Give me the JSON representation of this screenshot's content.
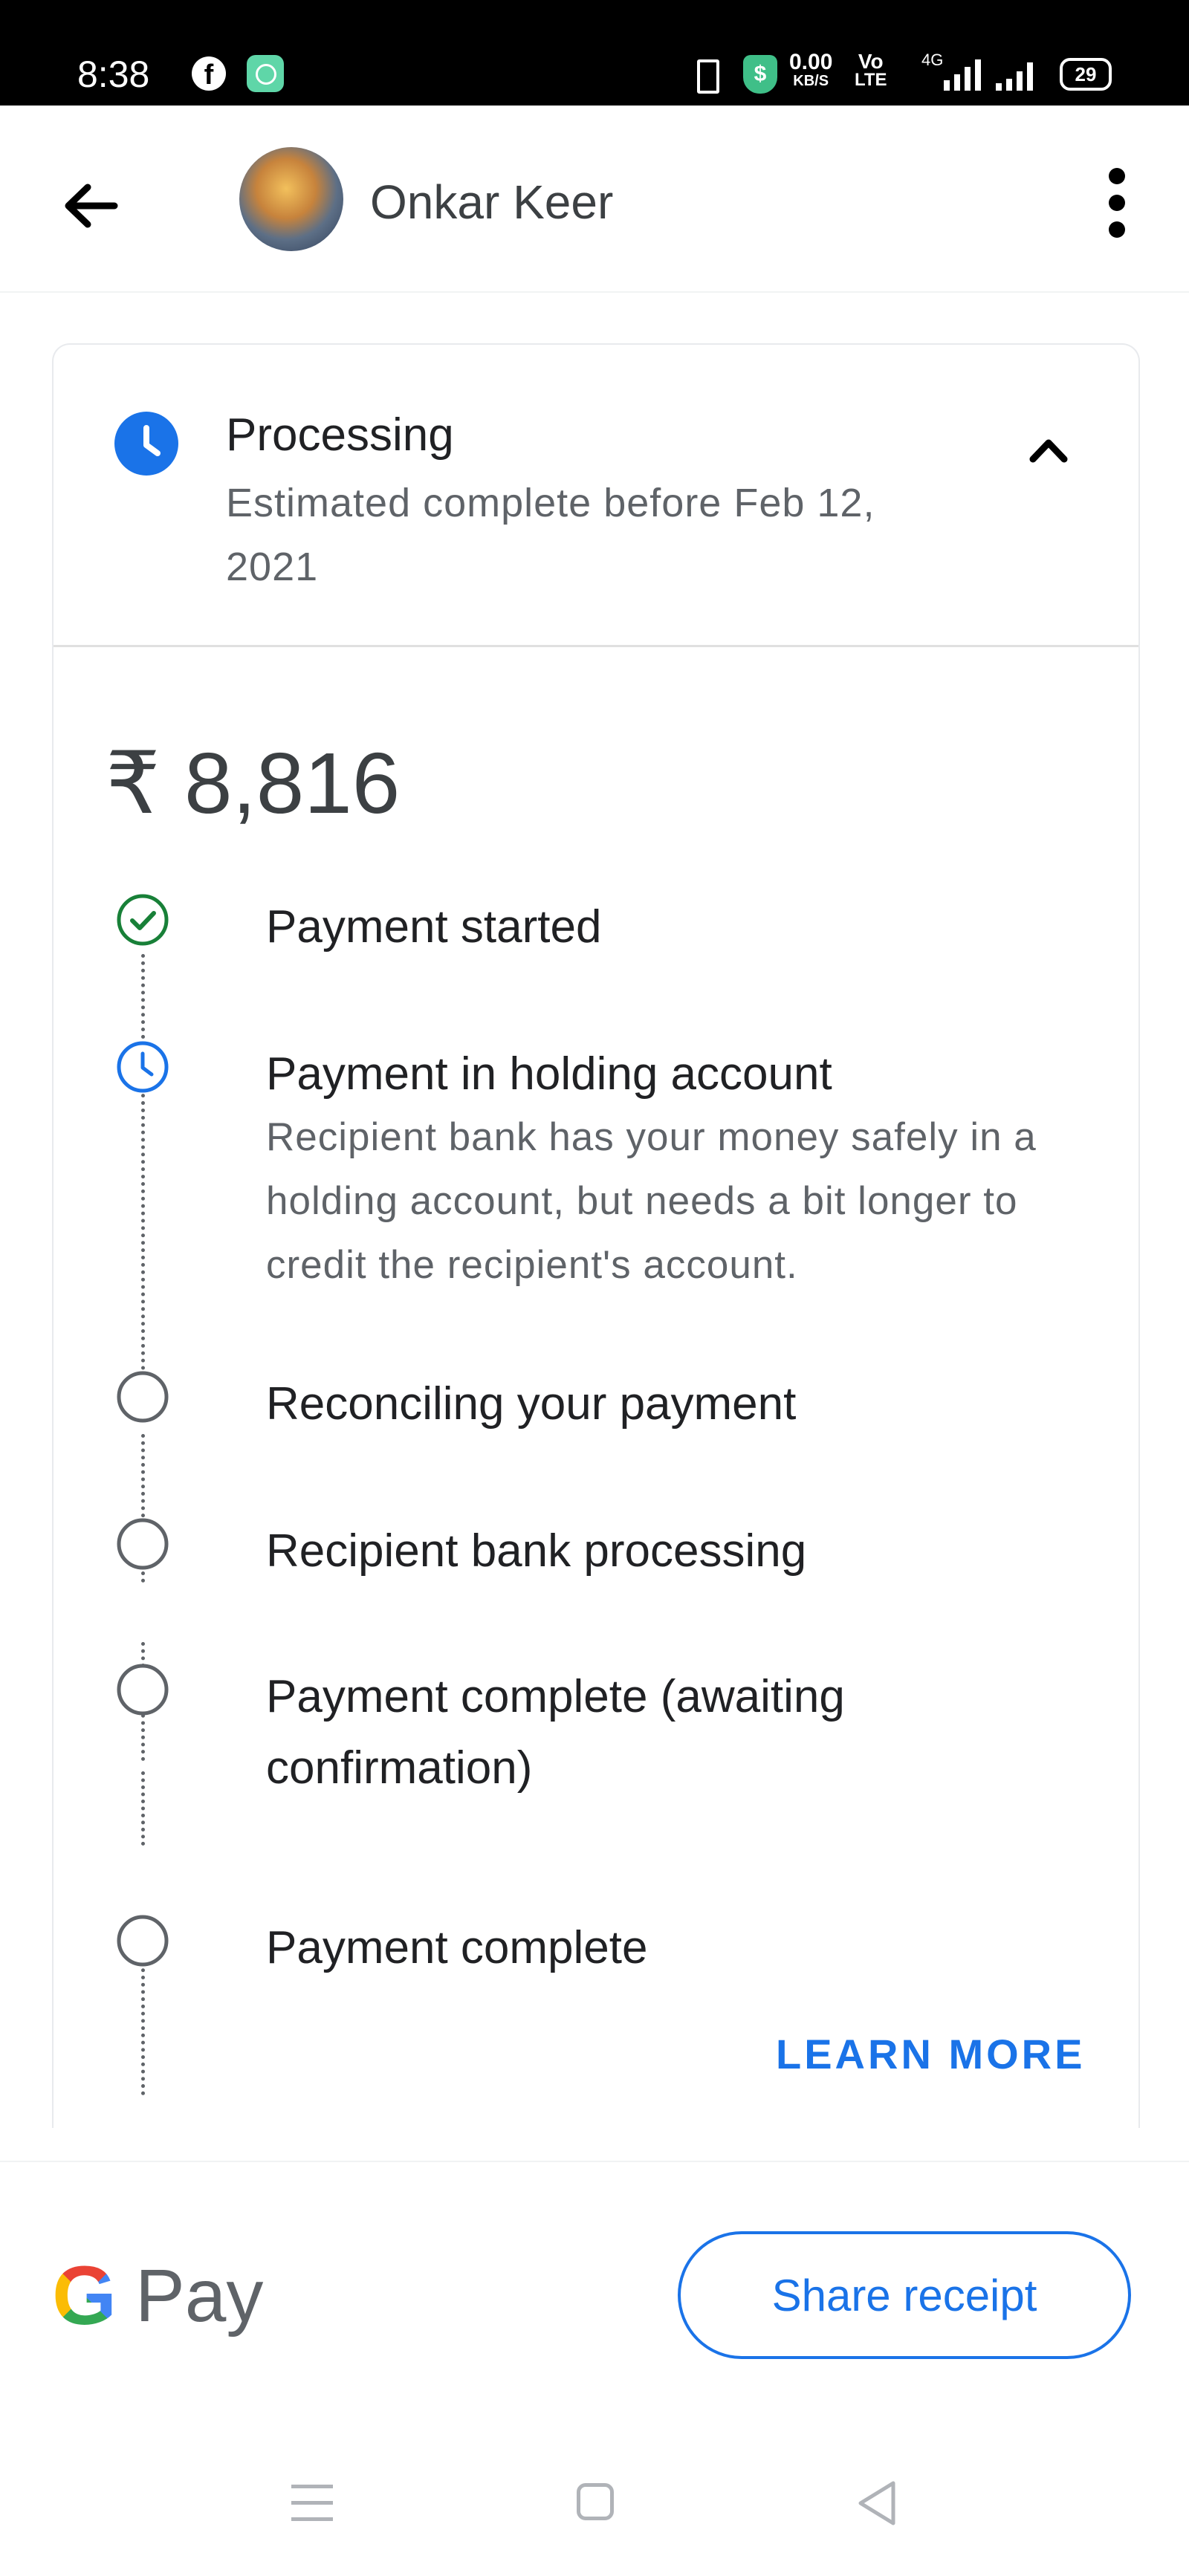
{
  "status_bar": {
    "time": "8:38",
    "net_speed": "0.00",
    "net_unit": "KB/S",
    "volte_top": "Vo",
    "volte_bottom": "LTE",
    "network_type": "4G",
    "battery": "29",
    "icons": [
      "facebook-icon",
      "app-icon",
      "vibrate-icon",
      "shield-icon",
      "signal-icon",
      "signal-icon",
      "battery-icon"
    ]
  },
  "header": {
    "contact_name": "Onkar Keer"
  },
  "status": {
    "title": "Processing",
    "subtitle": "Estimated complete before Feb 12, 2021"
  },
  "amount": "₹ 8,816",
  "timeline": [
    {
      "title": "Payment started",
      "state": "done"
    },
    {
      "title": "Payment in holding account",
      "description": "Recipient bank has your money safely in a holding account, but needs a bit longer to credit the recipient's account.",
      "state": "current"
    },
    {
      "title": "Reconciling your payment",
      "state": "pending"
    },
    {
      "title": "Recipient bank processing",
      "state": "pending"
    },
    {
      "title": "Payment complete (awaiting confirmation)",
      "state": "pending"
    },
    {
      "title": "Payment complete",
      "state": "pending"
    }
  ],
  "learn_more_label": "LEARN MORE",
  "footer": {
    "logo_letter": "G",
    "logo_text": "Pay",
    "share_label": "Share receipt"
  },
  "colors": {
    "accent": "#1a73e8",
    "done_green": "#188038",
    "text_primary": "#202124",
    "text_secondary": "#5f6368"
  }
}
